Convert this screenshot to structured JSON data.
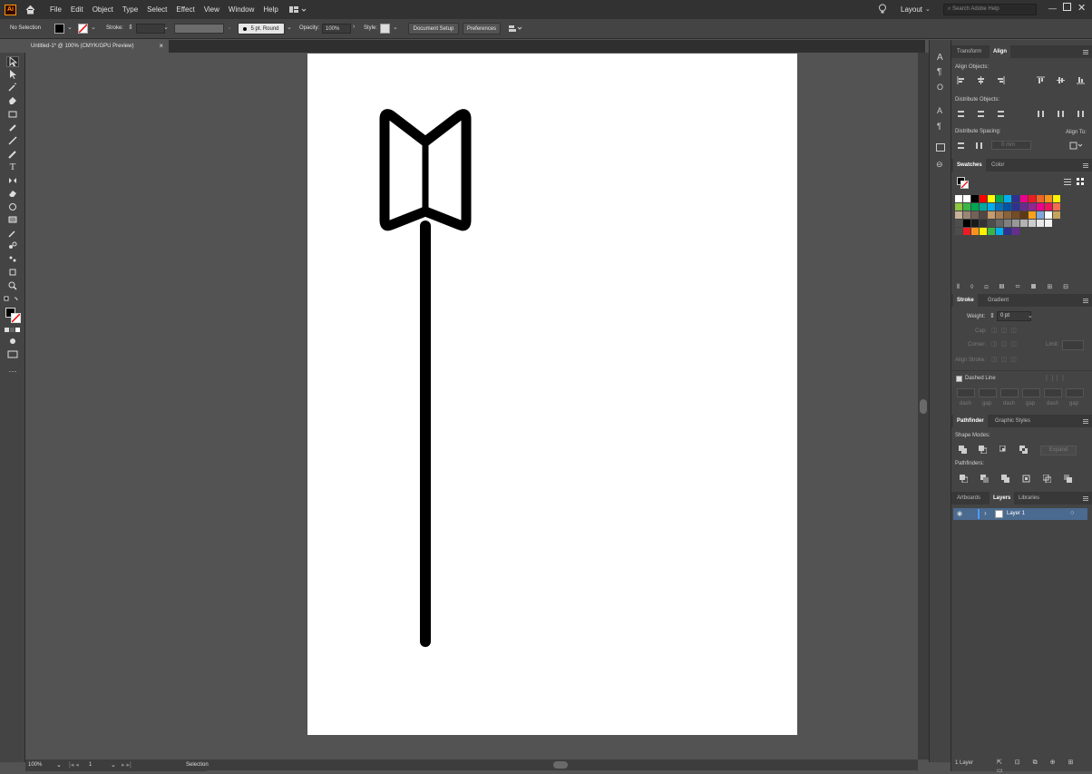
{
  "app": {
    "logo": "Ai"
  },
  "menu": [
    "File",
    "Edit",
    "Object",
    "Type",
    "Select",
    "Effect",
    "View",
    "Window",
    "Help"
  ],
  "workspace": {
    "label": "Layout",
    "search_placeholder": "Search Adobe Help"
  },
  "control": {
    "selection": "No Selection",
    "stroke_label": "Stroke:",
    "brush": "5 pt. Round",
    "opacity_label": "Opacity:",
    "opacity_value": "100%",
    "style_label": "Style:",
    "document_setup": "Document Setup",
    "preferences": "Preferences"
  },
  "document_tab": {
    "title": "Untitled-1* @ 100% (CMYK/GPU Preview)",
    "close": "×"
  },
  "status": {
    "zoom": "100%",
    "artboard": "1",
    "tool": "Selection"
  },
  "panels": {
    "top_tabs": [
      "Transform",
      "Align"
    ],
    "align_objects": "Align Objects:",
    "distribute_objects": "Distribute Objects:",
    "distribute_spacing": "Distribute Spacing:",
    "align_to": "Align To:",
    "spacing_value": "0 mm",
    "swatch_tabs": [
      "Swatches",
      "Color"
    ],
    "stroke_tabs": [
      "Stroke",
      "Gradient"
    ],
    "weight_label": "Weight:",
    "weight_value": "0 pt",
    "cap_label": "Cap:",
    "corner_label": "Corner:",
    "limit_label": "Limit:",
    "align_stroke_label": "Align Stroke:",
    "dashed_line": "Dashed Line",
    "dash_labels": [
      "dash",
      "gap",
      "dash",
      "gap",
      "dash",
      "gap"
    ],
    "pathfinder_tabs": [
      "Pathfinder",
      "Graphic Styles"
    ],
    "shape_modes": "Shape Modes:",
    "expand": "Expand",
    "pathfinders": "Pathfinders:",
    "layer_tabs": [
      "Artboards",
      "Layers",
      "Libraries"
    ],
    "layer_name": "Layer 1",
    "layer_count": "1 Layer"
  },
  "colors": {
    "menubar": "#323232",
    "panel": "#444444",
    "canvas": "#535353",
    "artboard": "#ffffff",
    "selection": "#4b6a8f"
  },
  "swatches": [
    [
      "#ffffff",
      "#ffffff",
      "#000000",
      "#ff0000",
      "#ffff00",
      "#00a651",
      "#00aeef",
      "#2e3192",
      "#ec008c",
      "#ed1c24",
      "#f26522",
      "#f7941d",
      "#fff200"
    ],
    [
      "#8dc63f",
      "#39b54a",
      "#00a651",
      "#00a99d",
      "#00aeef",
      "#0072bc",
      "#0054a6",
      "#2e3192",
      "#662d91",
      "#92278f",
      "#ec008c",
      "#ed145b",
      "#f26c4f"
    ],
    [
      "#c7b299",
      "#998675",
      "#736357",
      "#534741",
      "#c69c6d",
      "#a67c52",
      "#8c6239",
      "#754c24",
      "#603913",
      "#f9a11b",
      "#7da7d9",
      "#ffffff",
      "#c4a35a"
    ],
    [
      "#4d4d4d",
      "#000000",
      "#1a1a1a",
      "#333333",
      "#4d4d4d",
      "#666666",
      "#808080",
      "#999999",
      "#b3b3b3",
      "#cccccc",
      "#e6e6e6",
      "#f2f2f2"
    ],
    [
      "#4d4d4d",
      "#ed1c24",
      "#f7941d",
      "#fff200",
      "#39b54a",
      "#00aeef",
      "#2e3192",
      "#662d91"
    ]
  ]
}
